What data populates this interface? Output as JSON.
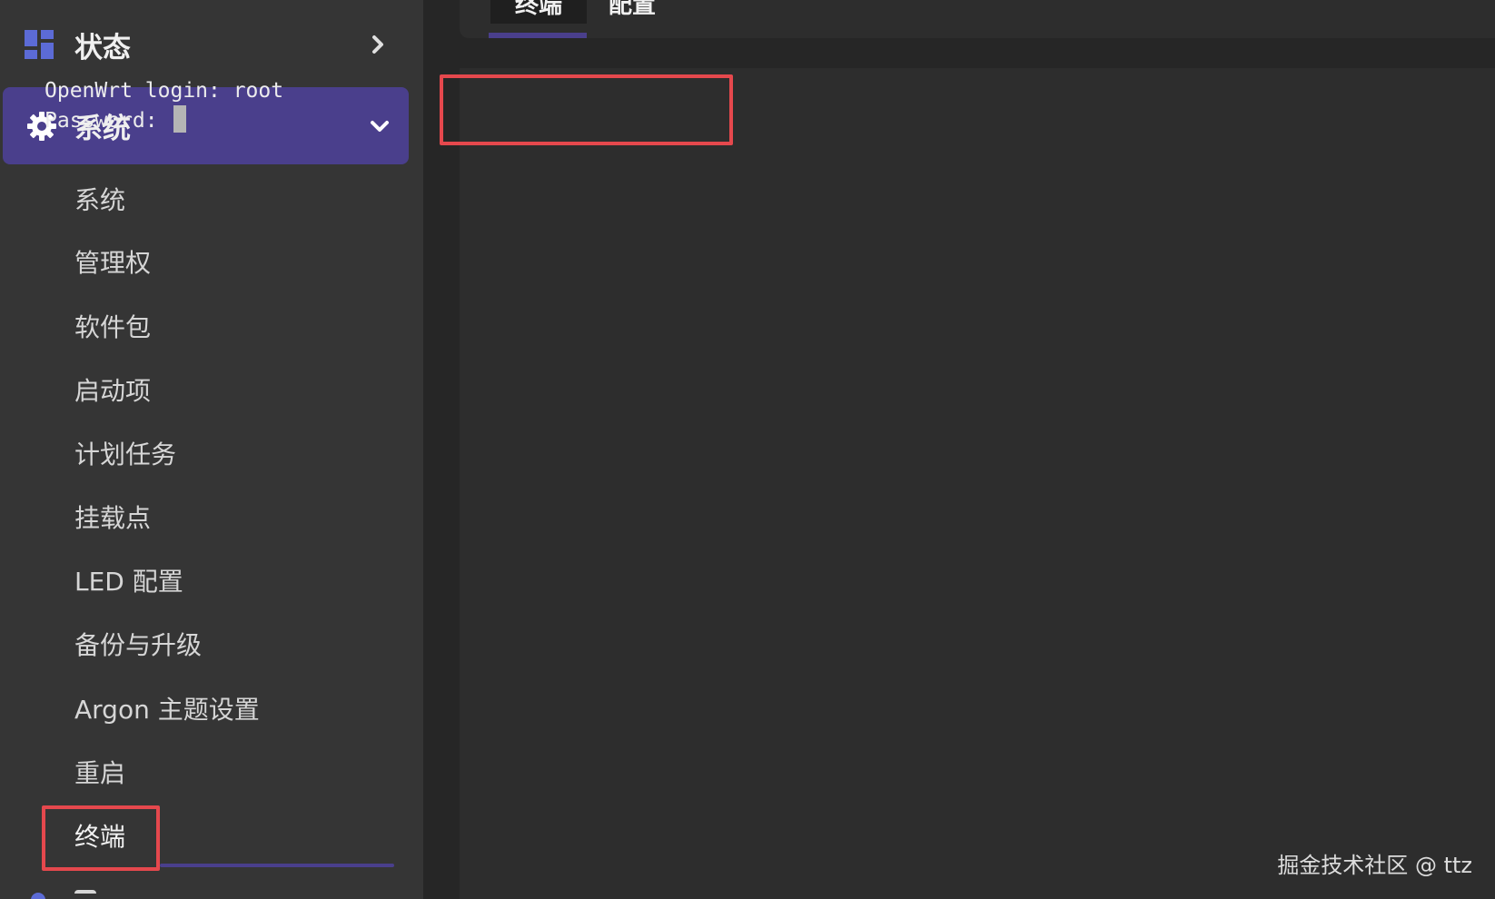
{
  "sidebar": {
    "status": {
      "label": "状态",
      "icon": "dashboard-icon"
    },
    "system": {
      "label": "系统",
      "icon": "gear-icon"
    },
    "submenu": [
      {
        "label": "系统"
      },
      {
        "label": "管理权"
      },
      {
        "label": "软件包"
      },
      {
        "label": "启动项"
      },
      {
        "label": "计划任务"
      },
      {
        "label": "挂载点"
      },
      {
        "label": "LED 配置"
      },
      {
        "label": "备份与升级"
      },
      {
        "label": "Argon 主题设置"
      },
      {
        "label": "重启"
      },
      {
        "label": "终端",
        "active": true
      }
    ]
  },
  "tabs": [
    {
      "label": "终端",
      "active": true
    },
    {
      "label": "配置",
      "active": false
    }
  ],
  "terminal": {
    "line1": "OpenWrt login: root",
    "line2": "Password: "
  },
  "watermark": "掘金技术社区 @ ttz",
  "colors": {
    "accent": "#4a3f8c",
    "highlight_box": "#e5484d",
    "sidebar_bg": "#353535",
    "terminal_bg": "#2d2d2d",
    "status_icon": "#5c6bd6"
  }
}
